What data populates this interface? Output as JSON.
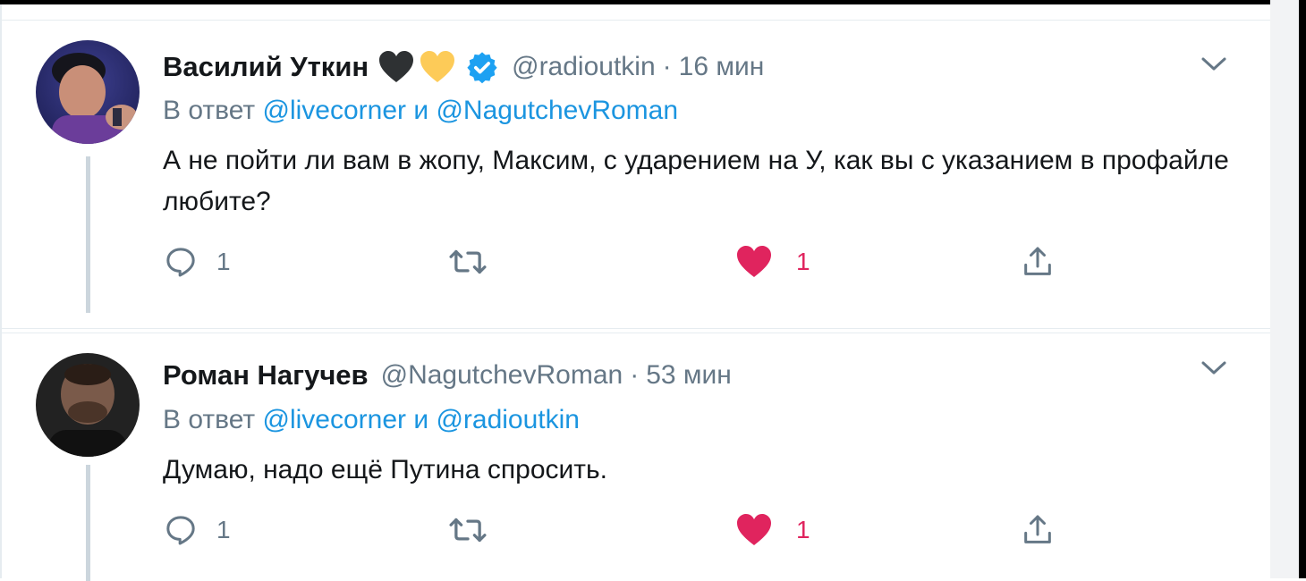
{
  "tweets": [
    {
      "name": "Василий Уткин",
      "handle": "@radioutkin",
      "separator": "·",
      "time": "16 мин",
      "verified": true,
      "emojis": [
        "black-heart-icon",
        "yellow-heart-icon"
      ],
      "reply_prefix": "В ответ",
      "reply_user1": "@livecorner",
      "reply_and": "и",
      "reply_user2": "@NagutchevRoman",
      "text": "А не пойти ли вам в жопу, Максим, с ударением на У, как вы с указанием в профайле любите?",
      "reply_count": "1",
      "like_count": "1"
    },
    {
      "name": "Роман Нагучев",
      "handle": "@NagutchevRoman",
      "separator": "·",
      "time": "53 мин",
      "verified": false,
      "reply_prefix": "В ответ",
      "reply_user1": "@livecorner",
      "reply_and": "и",
      "reply_user2": "@radioutkin",
      "text": "Думаю, надо ещё Путина спросить.",
      "reply_count": "1",
      "like_count": "1"
    }
  ],
  "colors": {
    "accent": "#1b95e0",
    "like": "#e0245e",
    "muted": "#657786",
    "text": "#14171a"
  }
}
